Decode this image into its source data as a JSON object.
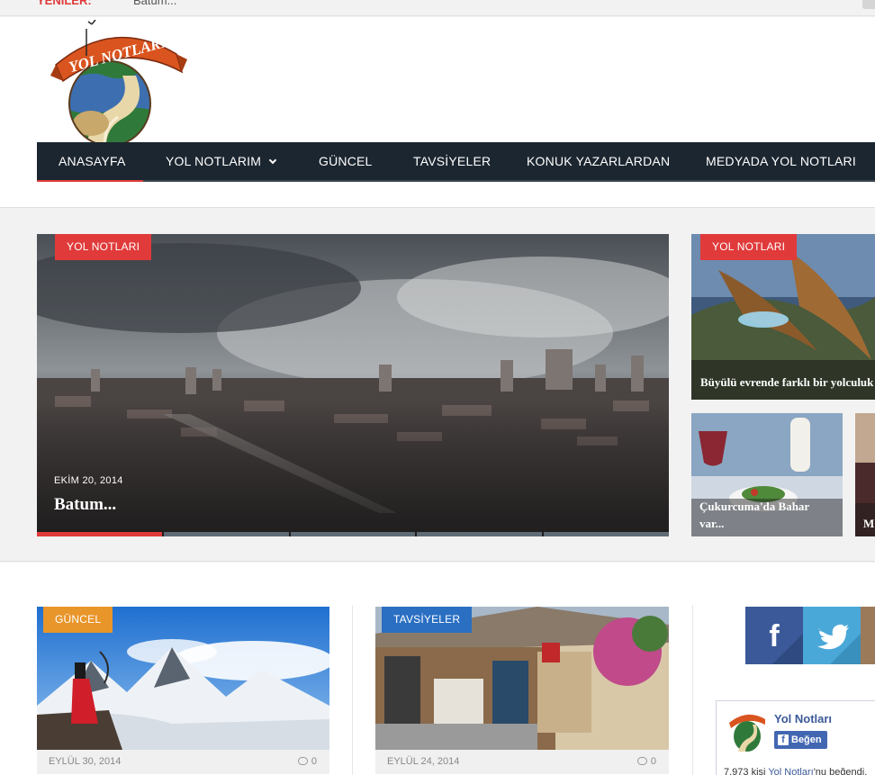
{
  "ticker": {
    "label": "YENİLER:",
    "text": "Batum..."
  },
  "site": {
    "logo_text": "YOL NOTLARI"
  },
  "nav": {
    "items": [
      {
        "label": "ANASAYFA"
      },
      {
        "label": "YOL NOTLARIM"
      },
      {
        "label": "GÜNCEL"
      },
      {
        "label": "TAVSİYELER"
      },
      {
        "label": "KONUK YAZARLARDAN"
      },
      {
        "label": "MEDYADA YOL NOTLARI"
      }
    ]
  },
  "featured": {
    "main": {
      "category": "YOL NOTLARI",
      "date": "EKİM 20, 2014",
      "title": "Batum..."
    },
    "side": [
      {
        "category": "YOL NOTLARI",
        "title": "Büyülü evrende farklı bir yolculuk"
      },
      {
        "title": "Çukurcuma'da Bahar var..."
      },
      {
        "title": "M"
      }
    ]
  },
  "posts": [
    {
      "category": "GÜNCEL",
      "date": "EYLÜL 30, 2014",
      "comments": "0"
    },
    {
      "category": "TAVSİYELER",
      "date": "EYLÜL 24, 2014",
      "comments": "0"
    }
  ],
  "fb_widget": {
    "page_name": "Yol Notları",
    "like_label": "Beğen",
    "count_prefix": "7.973 kişi",
    "count_link": "Yol Notları",
    "count_suffix": "'nu beğendi."
  },
  "colors": {
    "accent": "#e03a3a",
    "nav_bg": "#1c2630",
    "facebook": "#3b5998",
    "twitter": "#4aa8d8"
  }
}
